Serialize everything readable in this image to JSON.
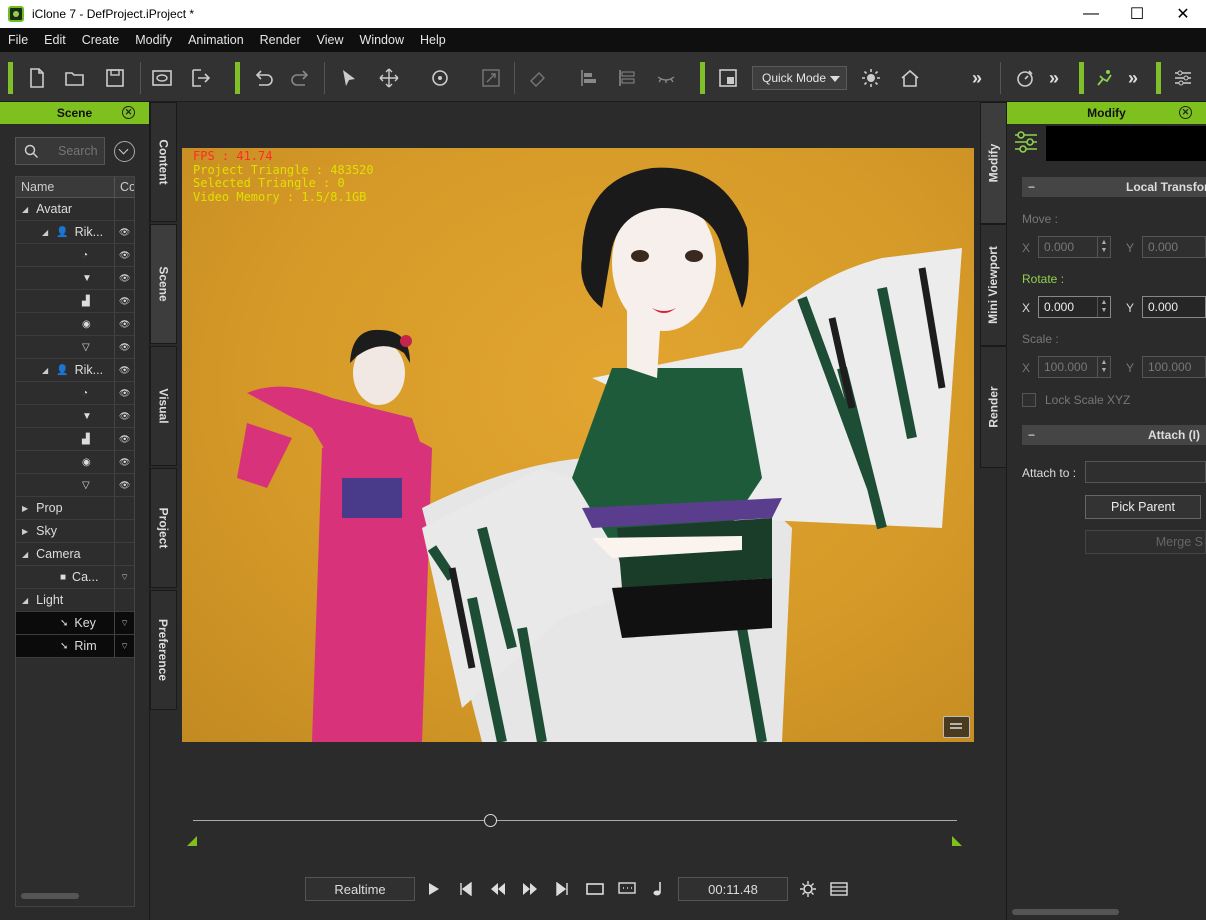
{
  "window": {
    "title": "iClone 7 - DefProject.iProject *",
    "minimize": "—",
    "maximize": "☐",
    "close": "✕"
  },
  "menu": [
    "File",
    "Edit",
    "Create",
    "Modify",
    "Animation",
    "Render",
    "View",
    "Window",
    "Help"
  ],
  "toolbar": {
    "mode_select": "Quick Mode",
    "more": "»"
  },
  "scene_panel": {
    "title": "Scene",
    "search_placeholder": "Search",
    "columns": [
      "Name",
      "Co"
    ],
    "rows": [
      {
        "label": "Avatar",
        "level": 0,
        "expanded": true
      },
      {
        "label": "Rik...",
        "level": 1,
        "expanded": true,
        "icon": "person-icon"
      },
      {
        "label": "",
        "level": 2,
        "icon": "hair-icon"
      },
      {
        "label": "",
        "level": 2,
        "icon": "shirt-icon"
      },
      {
        "label": "",
        "level": 2,
        "icon": "shoe-icon"
      },
      {
        "label": "",
        "level": 2,
        "icon": "eye-icon"
      },
      {
        "label": "",
        "level": 2,
        "icon": "mouth-icon"
      },
      {
        "label": "Rik...",
        "level": 1,
        "expanded": true,
        "icon": "person-icon"
      },
      {
        "label": "",
        "level": 2,
        "icon": "hair-icon"
      },
      {
        "label": "",
        "level": 2,
        "icon": "shirt-icon"
      },
      {
        "label": "",
        "level": 2,
        "icon": "shoe-icon"
      },
      {
        "label": "",
        "level": 2,
        "icon": "eye-icon"
      },
      {
        "label": "",
        "level": 2,
        "icon": "mouth-icon"
      },
      {
        "label": "Prop",
        "level": 0,
        "expanded": false
      },
      {
        "label": "Sky",
        "level": 0,
        "expanded": false
      },
      {
        "label": "Camera",
        "level": 0,
        "expanded": true
      },
      {
        "label": "Ca...",
        "level": 1,
        "icon": "camera-icon"
      },
      {
        "label": "Light",
        "level": 0,
        "expanded": true
      },
      {
        "label": "Key",
        "level": 1,
        "icon": "light-icon",
        "selected": true
      },
      {
        "label": "Rim",
        "level": 1,
        "icon": "light-icon",
        "selected": true
      }
    ]
  },
  "left_tabs": [
    "Content",
    "Scene",
    "Visual",
    "Project",
    "Preference"
  ],
  "viewport": {
    "fps": "FPS : 41.74",
    "triangles": "Project Triangle : 483520",
    "selected": "Selected Triangle : 0",
    "memory": "Video Memory : 1.5/8.1GB"
  },
  "playback": {
    "mode": "Realtime",
    "time": "00:11.48",
    "position": 0.39
  },
  "right_tabs": [
    "Modify",
    "Mini Viewport",
    "Render"
  ],
  "modify_panel": {
    "title": "Modify",
    "local_transform": "Local Transform",
    "move": "Move :",
    "rotate": "Rotate :",
    "scale": "Scale :",
    "x": "X",
    "y": "Y",
    "move_x": "0.000",
    "move_y": "0.000",
    "rotate_x": "0.000",
    "rotate_y": "0.000",
    "scale_x": "100.000",
    "scale_y": "100.000",
    "lock_scale": "Lock Scale XYZ",
    "attach_section": "Attach  (I)",
    "attach_to": "Attach to :",
    "pick_parent": "Pick Parent",
    "merge": "Merge S"
  },
  "colors": {
    "accent": "#7ec11f",
    "hud_yellow": "#e0e000",
    "hud_red": "#ff2a2a",
    "viewport_bg": "#d69a28"
  }
}
